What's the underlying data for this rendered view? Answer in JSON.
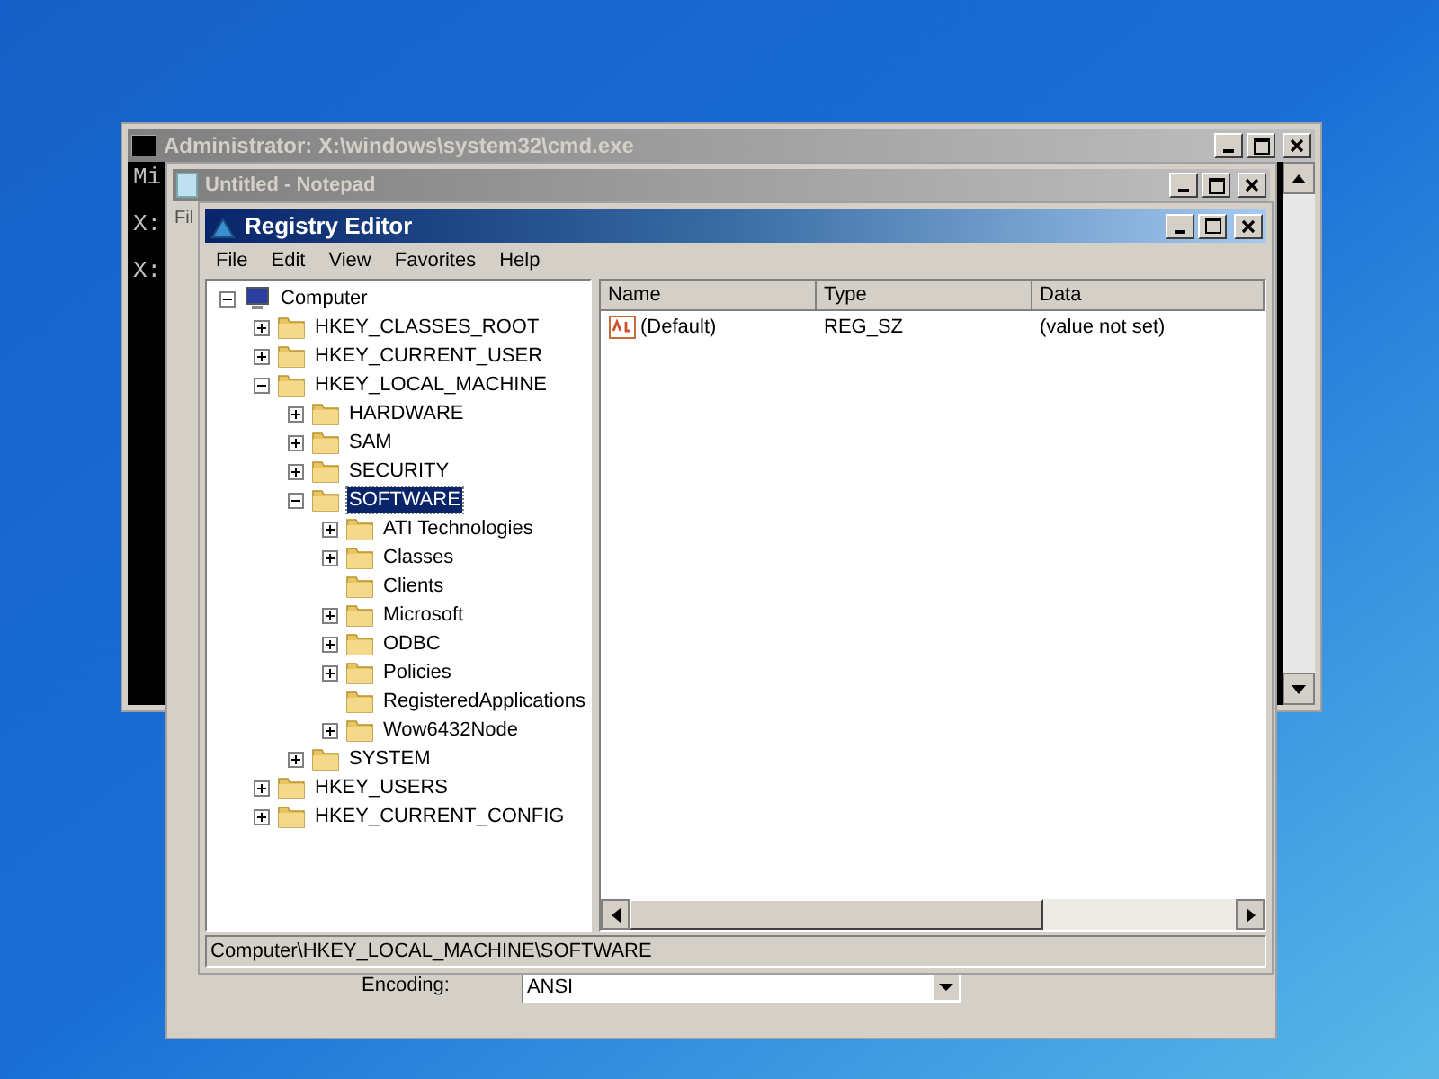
{
  "cmd_window": {
    "title": "Administrator: X:\\windows\\system32\\cmd.exe",
    "console_lines": [
      "Mi",
      "X:",
      "X:"
    ]
  },
  "notepad_window": {
    "title": "Untitled - Notepad",
    "menu_fragment": "Fil",
    "encoding_label": "Encoding:",
    "encoding_value": "ANSI"
  },
  "registry_window": {
    "title": "Registry Editor",
    "menu": [
      "File",
      "Edit",
      "View",
      "Favorites",
      "Help"
    ],
    "tree": [
      {
        "label": "Computer",
        "kind": "computer",
        "expanded": true,
        "selected": false,
        "children": [
          {
            "label": "HKEY_CLASSES_ROOT",
            "expanded": false,
            "selected": false
          },
          {
            "label": "HKEY_CURRENT_USER",
            "expanded": false,
            "selected": false
          },
          {
            "label": "HKEY_LOCAL_MACHINE",
            "expanded": true,
            "selected": false,
            "children": [
              {
                "label": "HARDWARE",
                "expanded": false,
                "selected": false
              },
              {
                "label": "SAM",
                "expanded": false,
                "selected": false
              },
              {
                "label": "SECURITY",
                "expanded": false,
                "selected": false
              },
              {
                "label": "SOFTWARE",
                "expanded": true,
                "selected": true,
                "children": [
                  {
                    "label": "ATI Technologies",
                    "expanded": false,
                    "selected": false
                  },
                  {
                    "label": "Classes",
                    "expanded": false,
                    "selected": false
                  },
                  {
                    "label": "Clients",
                    "selected": false
                  },
                  {
                    "label": "Microsoft",
                    "expanded": false,
                    "selected": false
                  },
                  {
                    "label": "ODBC",
                    "expanded": false,
                    "selected": false
                  },
                  {
                    "label": "Policies",
                    "expanded": false,
                    "selected": false
                  },
                  {
                    "label": "RegisteredApplications",
                    "selected": false
                  },
                  {
                    "label": "Wow6432Node",
                    "expanded": false,
                    "selected": false
                  }
                ]
              },
              {
                "label": "SYSTEM",
                "expanded": false,
                "selected": false
              }
            ]
          },
          {
            "label": "HKEY_USERS",
            "expanded": false,
            "selected": false
          },
          {
            "label": "HKEY_CURRENT_CONFIG",
            "expanded": false,
            "selected": false
          }
        ]
      }
    ],
    "columns": [
      "Name",
      "Type",
      "Data"
    ],
    "rows": [
      {
        "name": "(Default)",
        "type": "REG_SZ",
        "data": "(value not set)"
      }
    ],
    "status_bar": "Computer\\HKEY_LOCAL_MACHINE\\SOFTWARE"
  }
}
